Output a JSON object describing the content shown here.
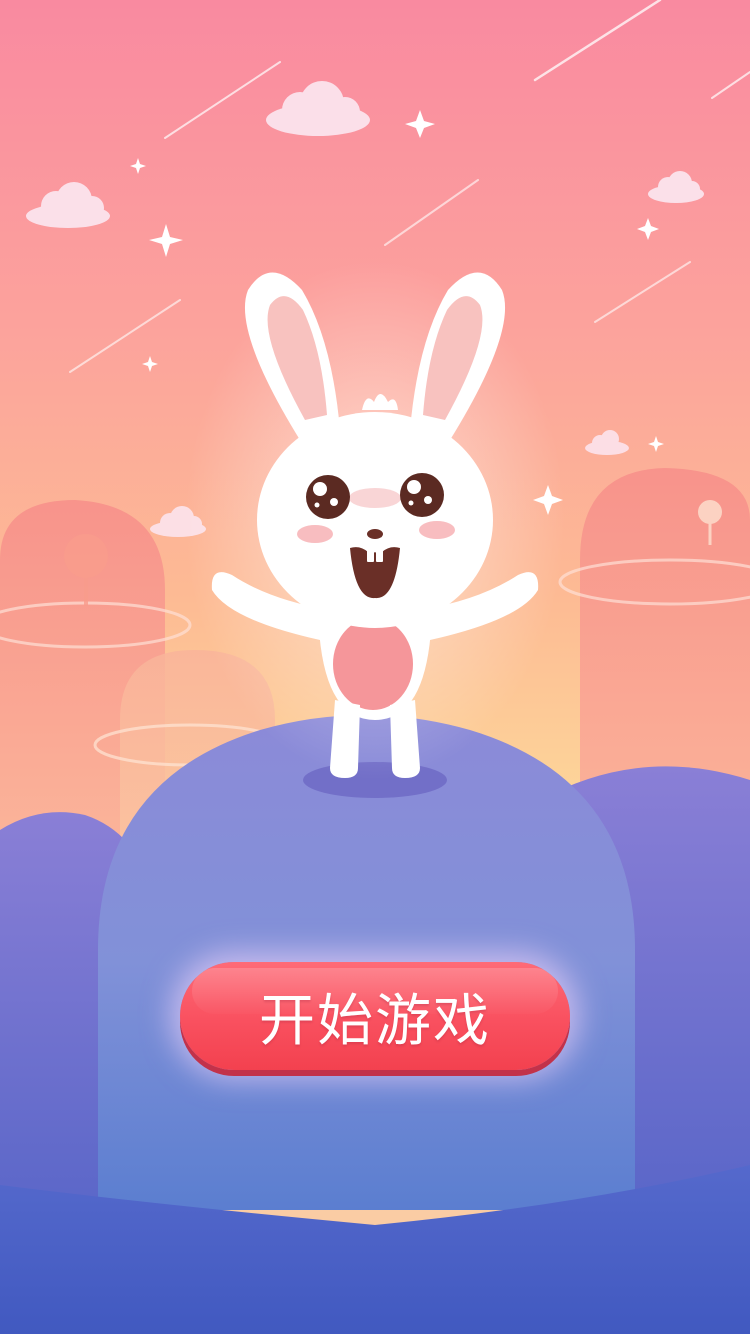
{
  "start_screen": {
    "start_button_label": "开始游戏"
  },
  "colors": {
    "sky_top": "#f98aa0",
    "sky_bottom": "#fdd99a",
    "hill_purple": "#8e8bd8",
    "ground_blue": "#4a63c6",
    "button_red": "#f9505f",
    "bunny_white": "#ffffff",
    "bunny_pink": "#f5969a"
  },
  "icons": [
    "bunny-character",
    "cloud-icon",
    "sparkle-icon",
    "shooting-star",
    "lollipop-tree"
  ]
}
